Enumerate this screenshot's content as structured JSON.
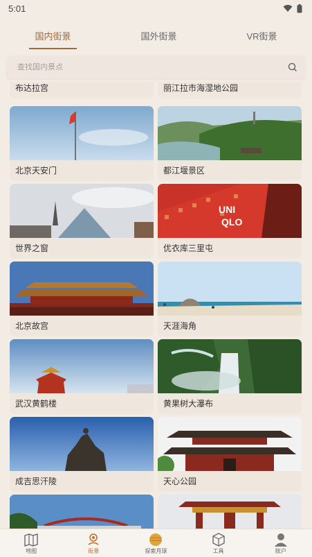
{
  "status": {
    "time": "5:01"
  },
  "tabs": [
    {
      "label": "国内街景",
      "active": true
    },
    {
      "label": "国外街景",
      "active": false
    },
    {
      "label": "VR街景",
      "active": false
    }
  ],
  "search": {
    "placeholder": "查找国内景点"
  },
  "top_row": [
    {
      "label": "布达拉宫"
    },
    {
      "label": "丽江拉市海湿地公园"
    }
  ],
  "cards": [
    {
      "label": "北京天安门",
      "scene": "tiananmen"
    },
    {
      "label": "都江堰景区",
      "scene": "dujiangyan"
    },
    {
      "label": "世界之窗",
      "scene": "window"
    },
    {
      "label": "优衣库三里屯",
      "scene": "uniqlo"
    },
    {
      "label": "北京故宫",
      "scene": "gugong"
    },
    {
      "label": "天涯海角",
      "scene": "tianya"
    },
    {
      "label": "武汉黄鹤楼",
      "scene": "huanghelou"
    },
    {
      "label": "黄果树大瀑布",
      "scene": "waterfall"
    },
    {
      "label": "成吉思汗陵",
      "scene": "genghis"
    },
    {
      "label": "天心公园",
      "scene": "tianxin"
    }
  ],
  "bottom_row": [
    {
      "scene": "bridge"
    },
    {
      "scene": "gate"
    }
  ],
  "nav": [
    {
      "label": "地图",
      "icon": "map-icon",
      "active": false
    },
    {
      "label": "街景",
      "icon": "street-view-icon",
      "active": true
    },
    {
      "label": "探索月球",
      "icon": "moon-icon",
      "active": false
    },
    {
      "label": "工具",
      "icon": "cube-icon",
      "active": false
    },
    {
      "label": "账户",
      "icon": "user-icon",
      "active": false
    }
  ],
  "colors": {
    "accent": "#9b6a3f",
    "nav_active": "#c36a2d",
    "background": "#f3ece5",
    "card_label_bg": "#efe6de"
  }
}
